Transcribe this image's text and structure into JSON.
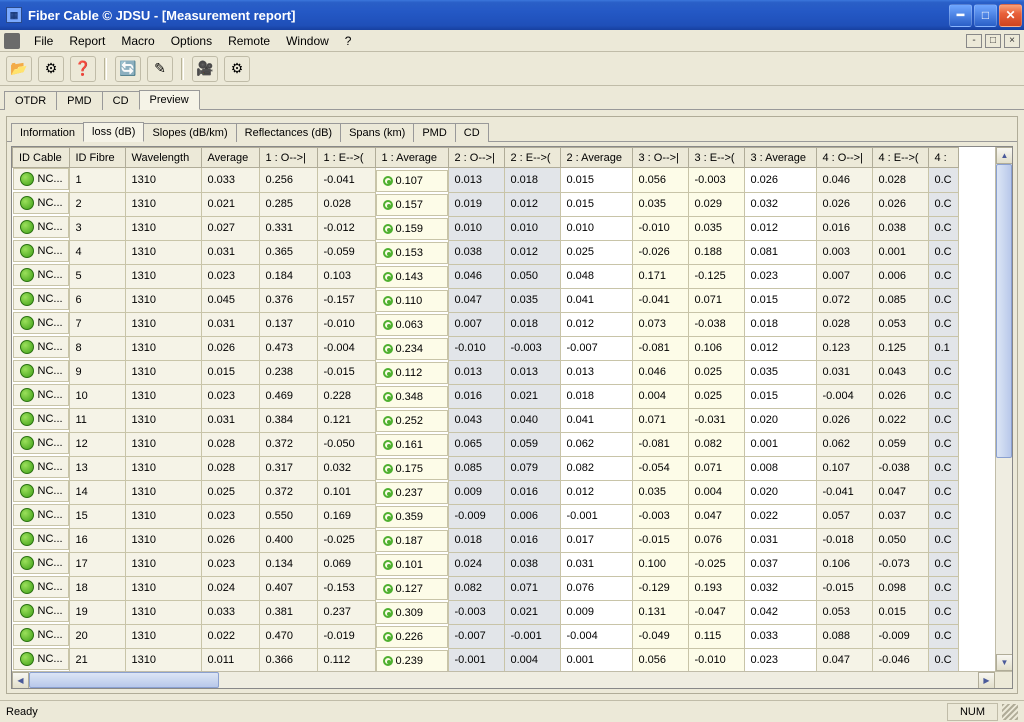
{
  "window": {
    "title": "Fiber Cable © JDSU - [Measurement report]"
  },
  "menu": [
    "File",
    "Report",
    "Macro",
    "Options",
    "Remote",
    "Window",
    "?"
  ],
  "toolbar_icons": [
    "open-icon",
    "settings-icon",
    "help-icon",
    "refresh-icon",
    "edit-icon",
    "camera-icon",
    "gear-icon"
  ],
  "outer_tabs": {
    "items": [
      "OTDR",
      "PMD",
      "CD",
      "Preview"
    ],
    "active": "Preview"
  },
  "inner_tabs": {
    "items": [
      "Information",
      "loss (dB)",
      "Slopes (dB/km)",
      "Reflectances (dB)",
      "Spans (km)",
      "PMD",
      "CD"
    ],
    "active": "loss (dB)"
  },
  "columns": [
    "ID Cable",
    "ID Fibre",
    "Wavelength",
    "Average",
    "1 : O-->|",
    "1 : E-->(",
    "1 : Average",
    "2 : O-->|",
    "2 : E-->(",
    "2 : Average",
    "3 : O-->|",
    "3 : E-->(",
    "3 : Average",
    "4 : O-->|",
    "4 : E-->(",
    "4 :"
  ],
  "rows": [
    {
      "idc": "NC...",
      "idf": "1",
      "wl": "1310",
      "avg": "0.033",
      "c1o": "0.256",
      "c1e": "-0.041",
      "c1a": "0.107",
      "c2o": "0.013",
      "c2e": "0.018",
      "c2a": "0.015",
      "c3o": "0.056",
      "c3e": "-0.003",
      "c3a": "0.026",
      "c4o": "0.046",
      "c4e": "0.028",
      "c4x": "0.C"
    },
    {
      "idc": "NC...",
      "idf": "2",
      "wl": "1310",
      "avg": "0.021",
      "c1o": "0.285",
      "c1e": "0.028",
      "c1a": "0.157",
      "c2o": "0.019",
      "c2e": "0.012",
      "c2a": "0.015",
      "c3o": "0.035",
      "c3e": "0.029",
      "c3a": "0.032",
      "c4o": "0.026",
      "c4e": "0.026",
      "c4x": "0.C"
    },
    {
      "idc": "NC...",
      "idf": "3",
      "wl": "1310",
      "avg": "0.027",
      "c1o": "0.331",
      "c1e": "-0.012",
      "c1a": "0.159",
      "c2o": "0.010",
      "c2e": "0.010",
      "c2a": "0.010",
      "c3o": "-0.010",
      "c3e": "0.035",
      "c3a": "0.012",
      "c4o": "0.016",
      "c4e": "0.038",
      "c4x": "0.C"
    },
    {
      "idc": "NC...",
      "idf": "4",
      "wl": "1310",
      "avg": "0.031",
      "c1o": "0.365",
      "c1e": "-0.059",
      "c1a": "0.153",
      "c2o": "0.038",
      "c2e": "0.012",
      "c2a": "0.025",
      "c3o": "-0.026",
      "c3e": "0.188",
      "c3a": "0.081",
      "c4o": "0.003",
      "c4e": "0.001",
      "c4x": "0.C"
    },
    {
      "idc": "NC...",
      "idf": "5",
      "wl": "1310",
      "avg": "0.023",
      "c1o": "0.184",
      "c1e": "0.103",
      "c1a": "0.143",
      "c2o": "0.046",
      "c2e": "0.050",
      "c2a": "0.048",
      "c3o": "0.171",
      "c3e": "-0.125",
      "c3a": "0.023",
      "c4o": "0.007",
      "c4e": "0.006",
      "c4x": "0.C"
    },
    {
      "idc": "NC...",
      "idf": "6",
      "wl": "1310",
      "avg": "0.045",
      "c1o": "0.376",
      "c1e": "-0.157",
      "c1a": "0.110",
      "c2o": "0.047",
      "c2e": "0.035",
      "c2a": "0.041",
      "c3o": "-0.041",
      "c3e": "0.071",
      "c3a": "0.015",
      "c4o": "0.072",
      "c4e": "0.085",
      "c4x": "0.C"
    },
    {
      "idc": "NC...",
      "idf": "7",
      "wl": "1310",
      "avg": "0.031",
      "c1o": "0.137",
      "c1e": "-0.010",
      "c1a": "0.063",
      "c2o": "0.007",
      "c2e": "0.018",
      "c2a": "0.012",
      "c3o": "0.073",
      "c3e": "-0.038",
      "c3a": "0.018",
      "c4o": "0.028",
      "c4e": "0.053",
      "c4x": "0.C"
    },
    {
      "idc": "NC...",
      "idf": "8",
      "wl": "1310",
      "avg": "0.026",
      "c1o": "0.473",
      "c1e": "-0.004",
      "c1a": "0.234",
      "c2o": "-0.010",
      "c2e": "-0.003",
      "c2a": "-0.007",
      "c3o": "-0.081",
      "c3e": "0.106",
      "c3a": "0.012",
      "c4o": "0.123",
      "c4e": "0.125",
      "c4x": "0.1"
    },
    {
      "idc": "NC...",
      "idf": "9",
      "wl": "1310",
      "avg": "0.015",
      "c1o": "0.238",
      "c1e": "-0.015",
      "c1a": "0.112",
      "c2o": "0.013",
      "c2e": "0.013",
      "c2a": "0.013",
      "c3o": "0.046",
      "c3e": "0.025",
      "c3a": "0.035",
      "c4o": "0.031",
      "c4e": "0.043",
      "c4x": "0.C"
    },
    {
      "idc": "NC...",
      "idf": "10",
      "wl": "1310",
      "avg": "0.023",
      "c1o": "0.469",
      "c1e": "0.228",
      "c1a": "0.348",
      "c2o": "0.016",
      "c2e": "0.021",
      "c2a": "0.018",
      "c3o": "0.004",
      "c3e": "0.025",
      "c3a": "0.015",
      "c4o": "-0.004",
      "c4e": "0.026",
      "c4x": "0.C"
    },
    {
      "idc": "NC...",
      "idf": "11",
      "wl": "1310",
      "avg": "0.031",
      "c1o": "0.384",
      "c1e": "0.121",
      "c1a": "0.252",
      "c2o": "0.043",
      "c2e": "0.040",
      "c2a": "0.041",
      "c3o": "0.071",
      "c3e": "-0.031",
      "c3a": "0.020",
      "c4o": "0.026",
      "c4e": "0.022",
      "c4x": "0.C"
    },
    {
      "idc": "NC...",
      "idf": "12",
      "wl": "1310",
      "avg": "0.028",
      "c1o": "0.372",
      "c1e": "-0.050",
      "c1a": "0.161",
      "c2o": "0.065",
      "c2e": "0.059",
      "c2a": "0.062",
      "c3o": "-0.081",
      "c3e": "0.082",
      "c3a": "0.001",
      "c4o": "0.062",
      "c4e": "0.059",
      "c4x": "0.C"
    },
    {
      "idc": "NC...",
      "idf": "13",
      "wl": "1310",
      "avg": "0.028",
      "c1o": "0.317",
      "c1e": "0.032",
      "c1a": "0.175",
      "c2o": "0.085",
      "c2e": "0.079",
      "c2a": "0.082",
      "c3o": "-0.054",
      "c3e": "0.071",
      "c3a": "0.008",
      "c4o": "0.107",
      "c4e": "-0.038",
      "c4x": "0.C"
    },
    {
      "idc": "NC...",
      "idf": "14",
      "wl": "1310",
      "avg": "0.025",
      "c1o": "0.372",
      "c1e": "0.101",
      "c1a": "0.237",
      "c2o": "0.009",
      "c2e": "0.016",
      "c2a": "0.012",
      "c3o": "0.035",
      "c3e": "0.004",
      "c3a": "0.020",
      "c4o": "-0.041",
      "c4e": "0.047",
      "c4x": "0.C"
    },
    {
      "idc": "NC...",
      "idf": "15",
      "wl": "1310",
      "avg": "0.023",
      "c1o": "0.550",
      "c1e": "0.169",
      "c1a": "0.359",
      "c2o": "-0.009",
      "c2e": "0.006",
      "c2a": "-0.001",
      "c3o": "-0.003",
      "c3e": "0.047",
      "c3a": "0.022",
      "c4o": "0.057",
      "c4e": "0.037",
      "c4x": "0.C"
    },
    {
      "idc": "NC...",
      "idf": "16",
      "wl": "1310",
      "avg": "0.026",
      "c1o": "0.400",
      "c1e": "-0.025",
      "c1a": "0.187",
      "c2o": "0.018",
      "c2e": "0.016",
      "c2a": "0.017",
      "c3o": "-0.015",
      "c3e": "0.076",
      "c3a": "0.031",
      "c4o": "-0.018",
      "c4e": "0.050",
      "c4x": "0.C"
    },
    {
      "idc": "NC...",
      "idf": "17",
      "wl": "1310",
      "avg": "0.023",
      "c1o": "0.134",
      "c1e": "0.069",
      "c1a": "0.101",
      "c2o": "0.024",
      "c2e": "0.038",
      "c2a": "0.031",
      "c3o": "0.100",
      "c3e": "-0.025",
      "c3a": "0.037",
      "c4o": "0.106",
      "c4e": "-0.073",
      "c4x": "0.C"
    },
    {
      "idc": "NC...",
      "idf": "18",
      "wl": "1310",
      "avg": "0.024",
      "c1o": "0.407",
      "c1e": "-0.153",
      "c1a": "0.127",
      "c2o": "0.082",
      "c2e": "0.071",
      "c2a": "0.076",
      "c3o": "-0.129",
      "c3e": "0.193",
      "c3a": "0.032",
      "c4o": "-0.015",
      "c4e": "0.098",
      "c4x": "0.C"
    },
    {
      "idc": "NC...",
      "idf": "19",
      "wl": "1310",
      "avg": "0.033",
      "c1o": "0.381",
      "c1e": "0.237",
      "c1a": "0.309",
      "c2o": "-0.003",
      "c2e": "0.021",
      "c2a": "0.009",
      "c3o": "0.131",
      "c3e": "-0.047",
      "c3a": "0.042",
      "c4o": "0.053",
      "c4e": "0.015",
      "c4x": "0.C"
    },
    {
      "idc": "NC...",
      "idf": "20",
      "wl": "1310",
      "avg": "0.022",
      "c1o": "0.470",
      "c1e": "-0.019",
      "c1a": "0.226",
      "c2o": "-0.007",
      "c2e": "-0.001",
      "c2a": "-0.004",
      "c3o": "-0.049",
      "c3e": "0.115",
      "c3a": "0.033",
      "c4o": "0.088",
      "c4e": "-0.009",
      "c4x": "0.C"
    },
    {
      "idc": "NC...",
      "idf": "21",
      "wl": "1310",
      "avg": "0.011",
      "c1o": "0.366",
      "c1e": "0.112",
      "c1a": "0.239",
      "c2o": "-0.001",
      "c2e": "0.004",
      "c2a": "0.001",
      "c3o": "0.056",
      "c3e": "-0.010",
      "c3a": "0.023",
      "c4o": "0.047",
      "c4e": "-0.046",
      "c4x": "0.C"
    }
  ],
  "status": {
    "ready": "Ready",
    "num": "NUM"
  }
}
